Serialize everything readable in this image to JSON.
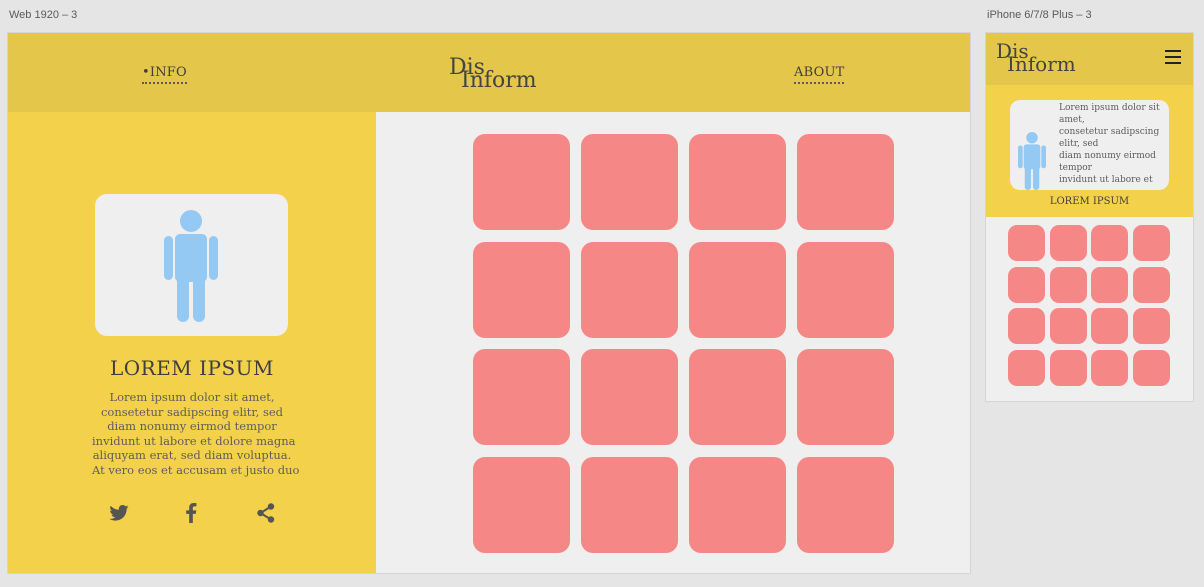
{
  "artboards": {
    "web_label": "Web 1920 – 3",
    "mobile_label": "iPhone 6/7/8 Plus – 3"
  },
  "brand": {
    "logo_line1": "Dis",
    "logo_line2": "Inform"
  },
  "nav": {
    "info_label": "•INFO",
    "about_label": "ABOUT"
  },
  "profile": {
    "title": "LOREM IPSUM",
    "body_lines": [
      "Lorem ipsum dolor sit amet,",
      "consetetur sadipscing elitr, sed",
      "diam nonumy eirmod tempor",
      "invidunt ut labore et dolore magna",
      "aliquyam erat, sed diam voluptua.",
      "At vero eos et accusam et justo duo"
    ]
  },
  "social": {
    "icons": [
      "twitter-icon",
      "facebook-icon",
      "share-icon"
    ]
  },
  "mobile": {
    "card_lines": [
      "Lorem ipsum dolor sit",
      "amet,",
      "consetetur sadipscing",
      "elitr, sed",
      "diam nonumy eirmod",
      "tempor",
      "invidunt ut labore et"
    ],
    "title": "LOREM IPSUM"
  },
  "grid": {
    "rows": 4,
    "cols": 4
  },
  "colors": {
    "header": "#e4c64a",
    "sidebar": "#f4d14a",
    "tile": "#f68787",
    "figure": "#94c9f4",
    "canvas": "#efefef"
  }
}
